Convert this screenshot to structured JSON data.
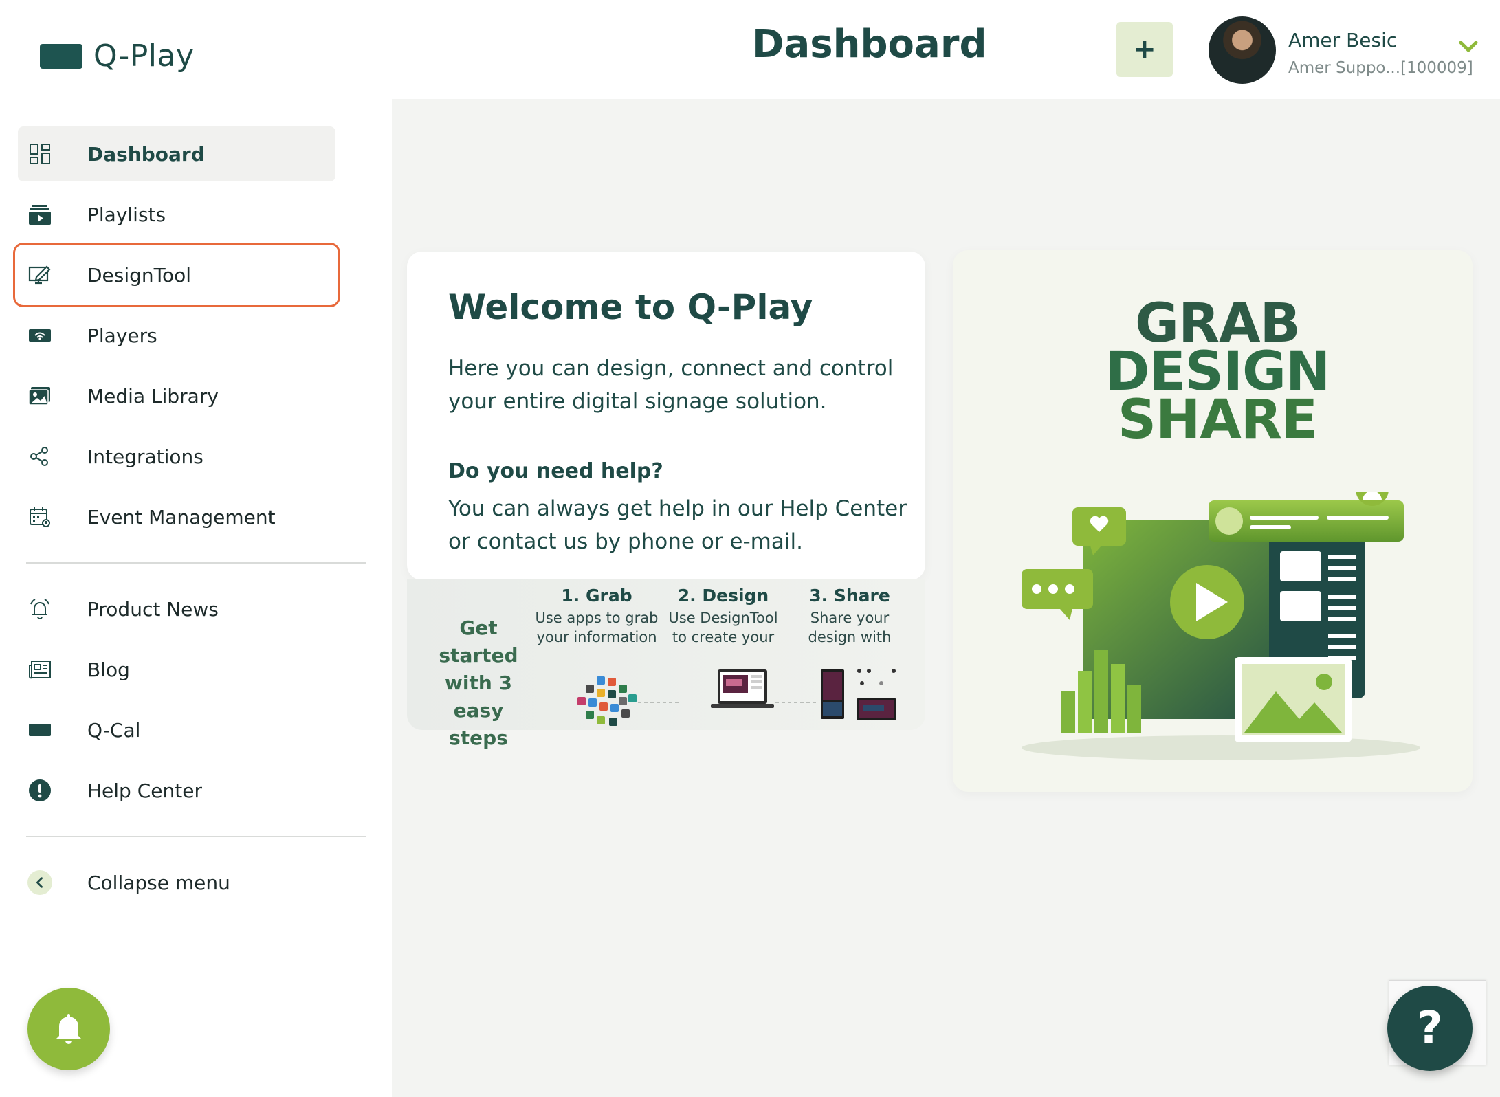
{
  "app": {
    "name": "Q-Play"
  },
  "header": {
    "title": "Dashboard",
    "add_label": "+",
    "user_name": "Amer Besic",
    "user_org": "Amer Suppo...[100009]"
  },
  "sidebar": {
    "items": [
      {
        "label": "Dashboard",
        "icon": "dashboard-grid-icon",
        "active": true
      },
      {
        "label": "Playlists",
        "icon": "playlist-icon"
      },
      {
        "label": "DesignTool",
        "icon": "design-edit-icon",
        "highlighted": true
      },
      {
        "label": "Players",
        "icon": "player-wifi-icon"
      },
      {
        "label": "Media Library",
        "icon": "media-image-icon"
      },
      {
        "label": "Integrations",
        "icon": "share-nodes-icon"
      },
      {
        "label": "Event Management",
        "icon": "calendar-icon"
      }
    ],
    "secondary": [
      {
        "label": "Product News",
        "icon": "bell-ring-icon"
      },
      {
        "label": "Blog",
        "icon": "newspaper-icon"
      },
      {
        "label": "Q-Cal",
        "icon": "qcal-icon"
      },
      {
        "label": "Help Center",
        "icon": "alert-circle-icon"
      }
    ],
    "collapse_label": "Collapse menu"
  },
  "welcome": {
    "title": "Welcome to Q-Play",
    "text": "Here you can design, connect and control your entire digital signage solution.",
    "help_title": "Do you need help?",
    "help_text": "You can always get help in our Help Center or contact us by phone or e-mail."
  },
  "steps": {
    "heading": "Get started with 3 easy steps",
    "items": [
      {
        "title": "1. Grab",
        "desc": "Use apps to grab your information"
      },
      {
        "title": "2. Design",
        "desc": "Use DesignTool to create your"
      },
      {
        "title": "3. Share",
        "desc": "Share your design with"
      }
    ]
  },
  "promo": {
    "line1": "GRAB",
    "line2": "DESIGN",
    "line3": "SHARE"
  },
  "help_fab": {
    "label": "?"
  },
  "colors": {
    "brand_dark": "#1f4a46",
    "brand_green": "#8fba3b",
    "highlight": "#e8693b",
    "main_bg": "#f3f4f2"
  }
}
